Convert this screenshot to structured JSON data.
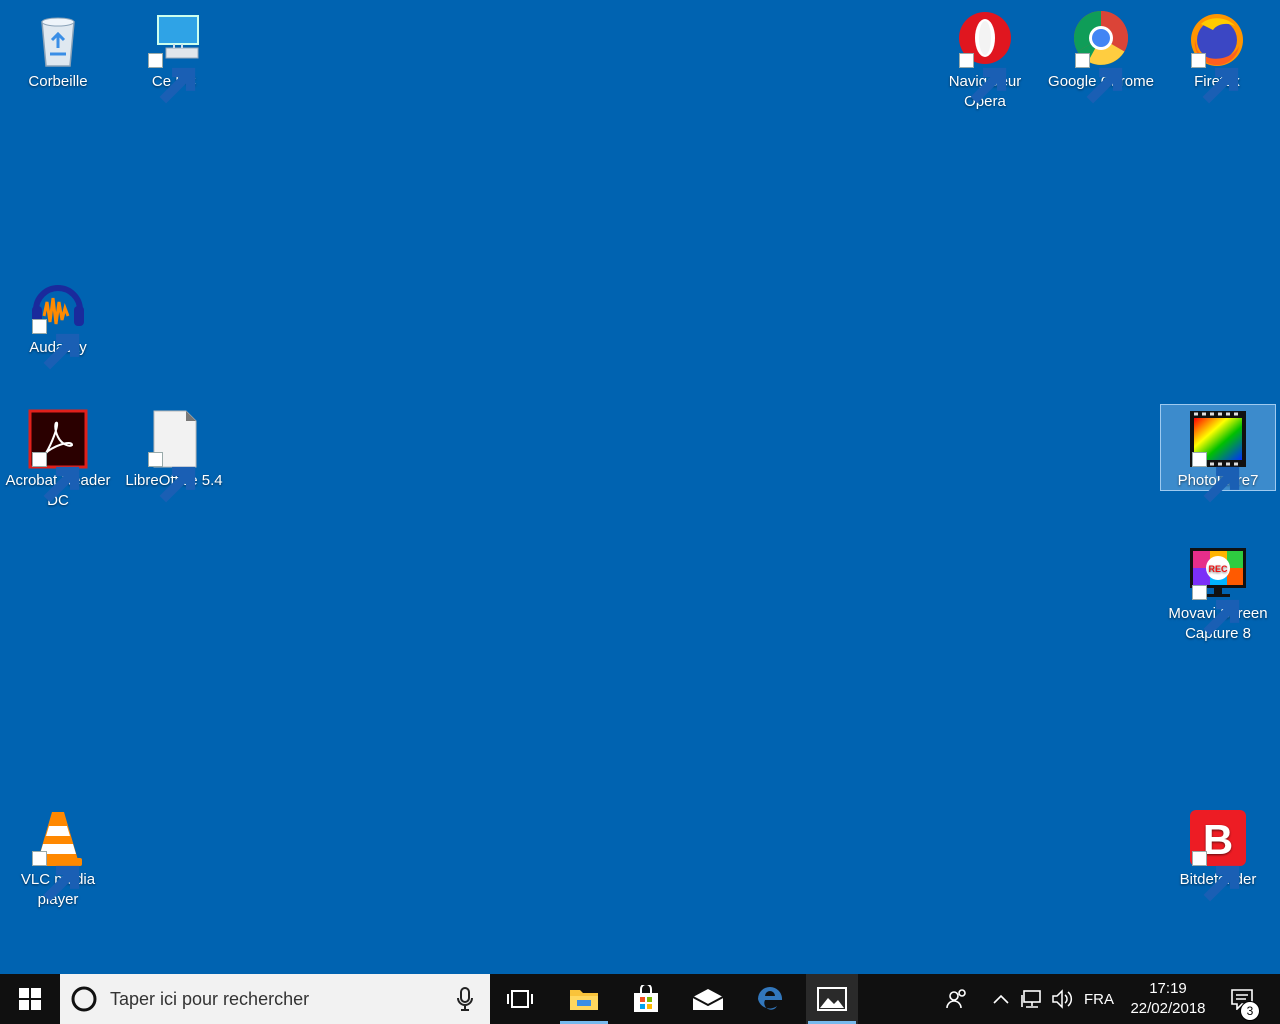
{
  "desktop": {
    "background_color": "#0063b1",
    "icons": [
      {
        "label": "Corbeille",
        "icon": "recycle-bin-icon",
        "shortcut": false
      },
      {
        "label": "Ce PC",
        "icon": "computer-icon",
        "shortcut": true
      },
      {
        "label": "Navigateur Opera",
        "icon": "opera-icon",
        "shortcut": true
      },
      {
        "label": "Google Chrome",
        "icon": "chrome-icon",
        "shortcut": true
      },
      {
        "label": "Firefox",
        "icon": "firefox-icon",
        "shortcut": true
      },
      {
        "label": "Audacity",
        "icon": "audacity-icon",
        "shortcut": true
      },
      {
        "label": "Acrobat Reader DC",
        "icon": "acrobat-reader-icon",
        "shortcut": true
      },
      {
        "label": "LibreOffice 5.4",
        "icon": "libreoffice-icon",
        "shortcut": true
      },
      {
        "label": "PhotoFiltre7",
        "icon": "photofiltre-icon",
        "shortcut": true,
        "selected": true
      },
      {
        "label": "Movavi Screen Capture 8",
        "icon": "movavi-icon",
        "shortcut": true,
        "badge": "REC"
      },
      {
        "label": "VLC media player",
        "icon": "vlc-icon",
        "shortcut": true
      },
      {
        "label": "Bitdefender",
        "icon": "bitdefender-icon",
        "shortcut": true,
        "glyph": "B"
      }
    ]
  },
  "taskbar": {
    "background_color": "#101010",
    "start_icon": "windows-start-icon",
    "search_placeholder": "Taper ici pour rechercher",
    "pinned": [
      {
        "name": "task-view",
        "icon": "task-view-icon"
      },
      {
        "name": "file-explorer",
        "icon": "folder-icon",
        "active": true
      },
      {
        "name": "microsoft-store",
        "icon": "store-icon"
      },
      {
        "name": "mail",
        "icon": "mail-icon"
      },
      {
        "name": "edge",
        "icon": "edge-icon"
      },
      {
        "name": "photos",
        "icon": "photos-icon",
        "active": true
      }
    ],
    "tray": {
      "people_icon": "people-icon",
      "chevron_icon": "chevron-up-icon",
      "network_icon": "network-icon",
      "volume_icon": "volume-icon",
      "language": "FRA",
      "time": "17:19",
      "date": "22/02/2018",
      "notification_count": "3"
    }
  }
}
